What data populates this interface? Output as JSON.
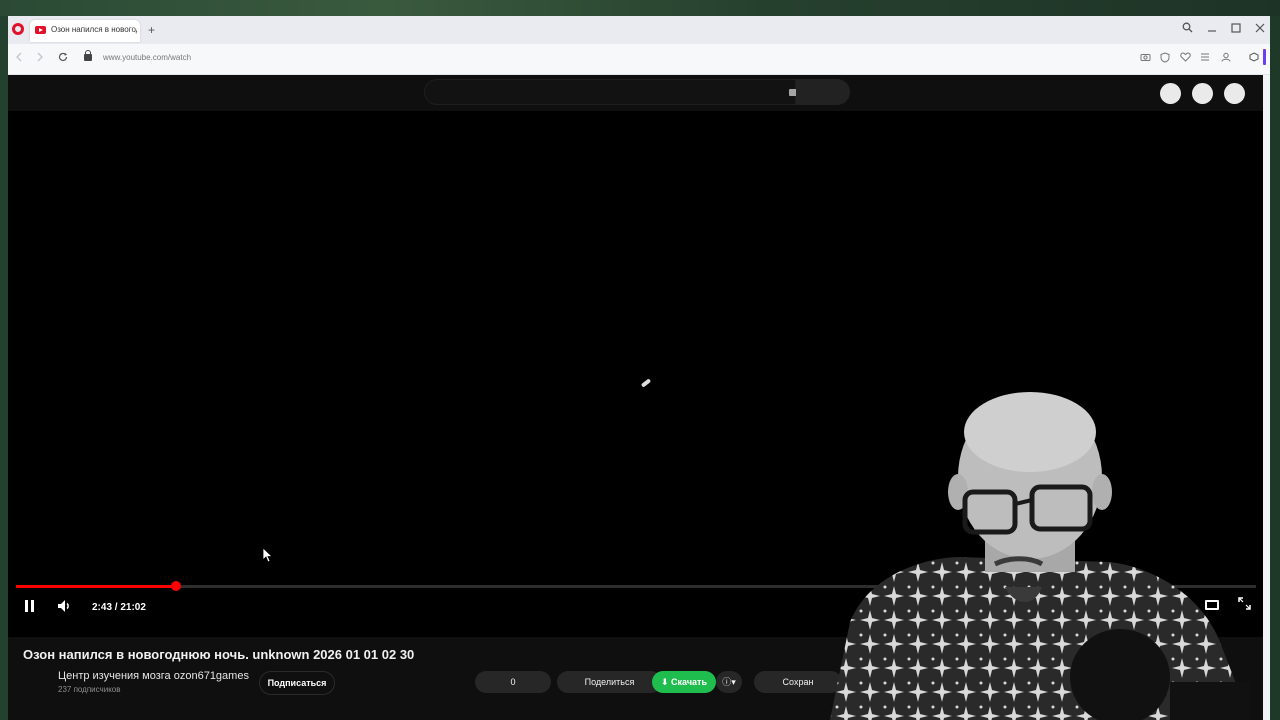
{
  "browser": {
    "tab_title": "Озон напился в новогод",
    "new_tab_symbol": "+",
    "url": "www.youtube.com/watch",
    "window_controls": [
      "🔍",
      "—",
      "☐",
      "✕"
    ],
    "toolbar_icons": [
      "camera-icon",
      "shield-icon",
      "heart-icon",
      "menu-icon",
      "account-icon",
      "extensions-icon"
    ]
  },
  "player": {
    "current_time": "2:43",
    "duration": "21:02",
    "time_display": "2:43 / 21:02",
    "progress_fraction": 0.1292
  },
  "video": {
    "title": "Озон напился в новогоднюю ночь. unknown 2026 01 01 02 30",
    "channel_name": "Центр изучения мозга ozon671games",
    "subscribers": "237 подписчиков",
    "subscribe_label": "Подписаться",
    "like_count": "0",
    "share_label": "Поделиться",
    "download_label": "Скачать",
    "save_label": "Сохран"
  },
  "colors": {
    "accent": "#ff0000",
    "download": "#1ebd4d",
    "opera": "#e0112b"
  }
}
